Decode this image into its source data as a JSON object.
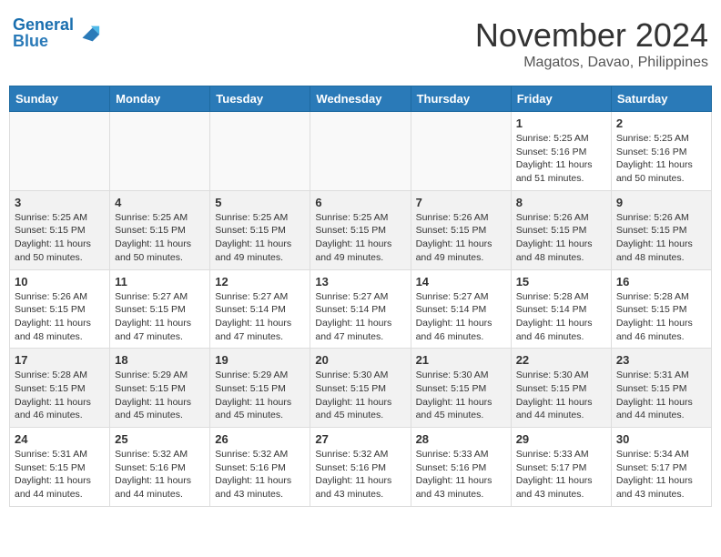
{
  "header": {
    "logo_line1": "General",
    "logo_line2": "Blue",
    "month": "November 2024",
    "location": "Magatos, Davao, Philippines"
  },
  "weekdays": [
    "Sunday",
    "Monday",
    "Tuesday",
    "Wednesday",
    "Thursday",
    "Friday",
    "Saturday"
  ],
  "weeks": [
    [
      {
        "day": "",
        "info": ""
      },
      {
        "day": "",
        "info": ""
      },
      {
        "day": "",
        "info": ""
      },
      {
        "day": "",
        "info": ""
      },
      {
        "day": "",
        "info": ""
      },
      {
        "day": "1",
        "info": "Sunrise: 5:25 AM\nSunset: 5:16 PM\nDaylight: 11 hours\nand 51 minutes."
      },
      {
        "day": "2",
        "info": "Sunrise: 5:25 AM\nSunset: 5:16 PM\nDaylight: 11 hours\nand 50 minutes."
      }
    ],
    [
      {
        "day": "3",
        "info": "Sunrise: 5:25 AM\nSunset: 5:15 PM\nDaylight: 11 hours\nand 50 minutes."
      },
      {
        "day": "4",
        "info": "Sunrise: 5:25 AM\nSunset: 5:15 PM\nDaylight: 11 hours\nand 50 minutes."
      },
      {
        "day": "5",
        "info": "Sunrise: 5:25 AM\nSunset: 5:15 PM\nDaylight: 11 hours\nand 49 minutes."
      },
      {
        "day": "6",
        "info": "Sunrise: 5:25 AM\nSunset: 5:15 PM\nDaylight: 11 hours\nand 49 minutes."
      },
      {
        "day": "7",
        "info": "Sunrise: 5:26 AM\nSunset: 5:15 PM\nDaylight: 11 hours\nand 49 minutes."
      },
      {
        "day": "8",
        "info": "Sunrise: 5:26 AM\nSunset: 5:15 PM\nDaylight: 11 hours\nand 48 minutes."
      },
      {
        "day": "9",
        "info": "Sunrise: 5:26 AM\nSunset: 5:15 PM\nDaylight: 11 hours\nand 48 minutes."
      }
    ],
    [
      {
        "day": "10",
        "info": "Sunrise: 5:26 AM\nSunset: 5:15 PM\nDaylight: 11 hours\nand 48 minutes."
      },
      {
        "day": "11",
        "info": "Sunrise: 5:27 AM\nSunset: 5:15 PM\nDaylight: 11 hours\nand 47 minutes."
      },
      {
        "day": "12",
        "info": "Sunrise: 5:27 AM\nSunset: 5:14 PM\nDaylight: 11 hours\nand 47 minutes."
      },
      {
        "day": "13",
        "info": "Sunrise: 5:27 AM\nSunset: 5:14 PM\nDaylight: 11 hours\nand 47 minutes."
      },
      {
        "day": "14",
        "info": "Sunrise: 5:27 AM\nSunset: 5:14 PM\nDaylight: 11 hours\nand 46 minutes."
      },
      {
        "day": "15",
        "info": "Sunrise: 5:28 AM\nSunset: 5:14 PM\nDaylight: 11 hours\nand 46 minutes."
      },
      {
        "day": "16",
        "info": "Sunrise: 5:28 AM\nSunset: 5:15 PM\nDaylight: 11 hours\nand 46 minutes."
      }
    ],
    [
      {
        "day": "17",
        "info": "Sunrise: 5:28 AM\nSunset: 5:15 PM\nDaylight: 11 hours\nand 46 minutes."
      },
      {
        "day": "18",
        "info": "Sunrise: 5:29 AM\nSunset: 5:15 PM\nDaylight: 11 hours\nand 45 minutes."
      },
      {
        "day": "19",
        "info": "Sunrise: 5:29 AM\nSunset: 5:15 PM\nDaylight: 11 hours\nand 45 minutes."
      },
      {
        "day": "20",
        "info": "Sunrise: 5:30 AM\nSunset: 5:15 PM\nDaylight: 11 hours\nand 45 minutes."
      },
      {
        "day": "21",
        "info": "Sunrise: 5:30 AM\nSunset: 5:15 PM\nDaylight: 11 hours\nand 45 minutes."
      },
      {
        "day": "22",
        "info": "Sunrise: 5:30 AM\nSunset: 5:15 PM\nDaylight: 11 hours\nand 44 minutes."
      },
      {
        "day": "23",
        "info": "Sunrise: 5:31 AM\nSunset: 5:15 PM\nDaylight: 11 hours\nand 44 minutes."
      }
    ],
    [
      {
        "day": "24",
        "info": "Sunrise: 5:31 AM\nSunset: 5:15 PM\nDaylight: 11 hours\nand 44 minutes."
      },
      {
        "day": "25",
        "info": "Sunrise: 5:32 AM\nSunset: 5:16 PM\nDaylight: 11 hours\nand 44 minutes."
      },
      {
        "day": "26",
        "info": "Sunrise: 5:32 AM\nSunset: 5:16 PM\nDaylight: 11 hours\nand 43 minutes."
      },
      {
        "day": "27",
        "info": "Sunrise: 5:32 AM\nSunset: 5:16 PM\nDaylight: 11 hours\nand 43 minutes."
      },
      {
        "day": "28",
        "info": "Sunrise: 5:33 AM\nSunset: 5:16 PM\nDaylight: 11 hours\nand 43 minutes."
      },
      {
        "day": "29",
        "info": "Sunrise: 5:33 AM\nSunset: 5:17 PM\nDaylight: 11 hours\nand 43 minutes."
      },
      {
        "day": "30",
        "info": "Sunrise: 5:34 AM\nSunset: 5:17 PM\nDaylight: 11 hours\nand 43 minutes."
      }
    ]
  ]
}
